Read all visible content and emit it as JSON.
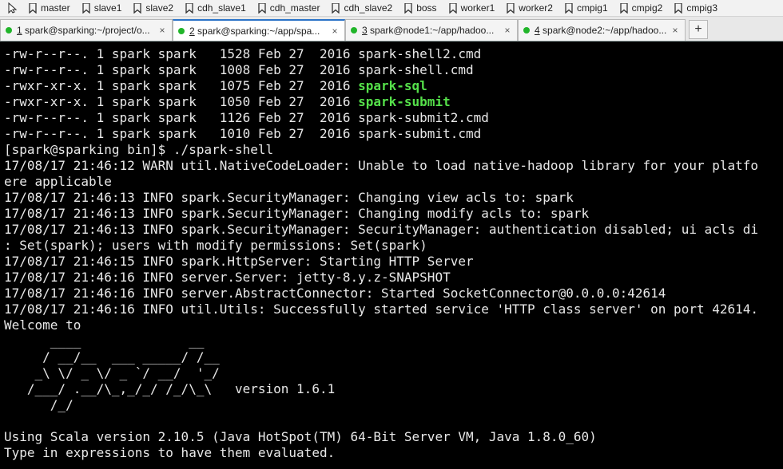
{
  "bookmarks": [
    "master",
    "slave1",
    "slave2",
    "cdh_slave1",
    "cdh_master",
    "cdh_slave2",
    "boss",
    "worker1",
    "worker2",
    "cmpig1",
    "cmpig2",
    "cmpig3"
  ],
  "tabs": [
    {
      "number": "1",
      "title": "spark@sparking:~/project/o...",
      "active": false
    },
    {
      "number": "2",
      "title": "spark@sparking:~/app/spa...",
      "active": true
    },
    {
      "number": "3",
      "title": "spark@node1:~/app/hadoo...",
      "active": false
    },
    {
      "number": "4",
      "title": "spark@node2:~/app/hadoo...",
      "active": false
    }
  ],
  "add_tab_label": "+",
  "close_label": "×",
  "colors": {
    "terminal_bg": "#000000",
    "terminal_fg": "#e8e8e8",
    "executable": "#55e04a",
    "status_dot": "#21b52a",
    "active_tab_accent": "#2a73c8"
  },
  "terminal": {
    "lines": [
      {
        "pre": "-rw-r--r--. 1 spark spark   1528 Feb 27  2016 ",
        "name": "spark-shell2.cmd",
        "exec": false
      },
      {
        "pre": "-rw-r--r--. 1 spark spark   1008 Feb 27  2016 ",
        "name": "spark-shell.cmd",
        "exec": false
      },
      {
        "pre": "-rwxr-xr-x. 1 spark spark   1075 Feb 27  2016 ",
        "name": "spark-sql",
        "exec": true
      },
      {
        "pre": "-rwxr-xr-x. 1 spark spark   1050 Feb 27  2016 ",
        "name": "spark-submit",
        "exec": true
      },
      {
        "pre": "-rw-r--r--. 1 spark spark   1126 Feb 27  2016 ",
        "name": "spark-submit2.cmd",
        "exec": false
      },
      {
        "pre": "-rw-r--r--. 1 spark spark   1010 Feb 27  2016 ",
        "name": "spark-submit.cmd",
        "exec": false
      },
      {
        "pre": "[spark@sparking bin]$ ./spark-shell",
        "name": "",
        "exec": false
      },
      {
        "pre": "17/08/17 21:46:12 WARN util.NativeCodeLoader: Unable to load native-hadoop library for your platfo",
        "name": "",
        "exec": false
      },
      {
        "pre": "ere applicable",
        "name": "",
        "exec": false
      },
      {
        "pre": "17/08/17 21:46:13 INFO spark.SecurityManager: Changing view acls to: spark",
        "name": "",
        "exec": false
      },
      {
        "pre": "17/08/17 21:46:13 INFO spark.SecurityManager: Changing modify acls to: spark",
        "name": "",
        "exec": false
      },
      {
        "pre": "17/08/17 21:46:13 INFO spark.SecurityManager: SecurityManager: authentication disabled; ui acls di",
        "name": "",
        "exec": false
      },
      {
        "pre": ": Set(spark); users with modify permissions: Set(spark)",
        "name": "",
        "exec": false
      },
      {
        "pre": "17/08/17 21:46:15 INFO spark.HttpServer: Starting HTTP Server",
        "name": "",
        "exec": false
      },
      {
        "pre": "17/08/17 21:46:16 INFO server.Server: jetty-8.y.z-SNAPSHOT",
        "name": "",
        "exec": false
      },
      {
        "pre": "17/08/17 21:46:16 INFO server.AbstractConnector: Started SocketConnector@0.0.0.0:42614",
        "name": "",
        "exec": false
      },
      {
        "pre": "17/08/17 21:46:16 INFO util.Utils: Successfully started service 'HTTP class server' on port 42614.",
        "name": "",
        "exec": false
      },
      {
        "pre": "Welcome to",
        "name": "",
        "exec": false
      },
      {
        "pre": "      ____              __",
        "name": "",
        "exec": false
      },
      {
        "pre": "     / __/__  ___ _____/ /__",
        "name": "",
        "exec": false
      },
      {
        "pre": "    _\\ \\/ _ \\/ _ `/ __/  '_/",
        "name": "",
        "exec": false
      },
      {
        "pre": "   /___/ .__/\\_,_/_/ /_/\\_\\   version 1.6.1",
        "name": "",
        "exec": false
      },
      {
        "pre": "      /_/",
        "name": "",
        "exec": false
      },
      {
        "pre": "",
        "name": "",
        "exec": false
      },
      {
        "pre": "Using Scala version 2.10.5 (Java HotSpot(TM) 64-Bit Server VM, Java 1.8.0_60)",
        "name": "",
        "exec": false
      },
      {
        "pre": "Type in expressions to have them evaluated.",
        "name": "",
        "exec": false
      }
    ]
  }
}
